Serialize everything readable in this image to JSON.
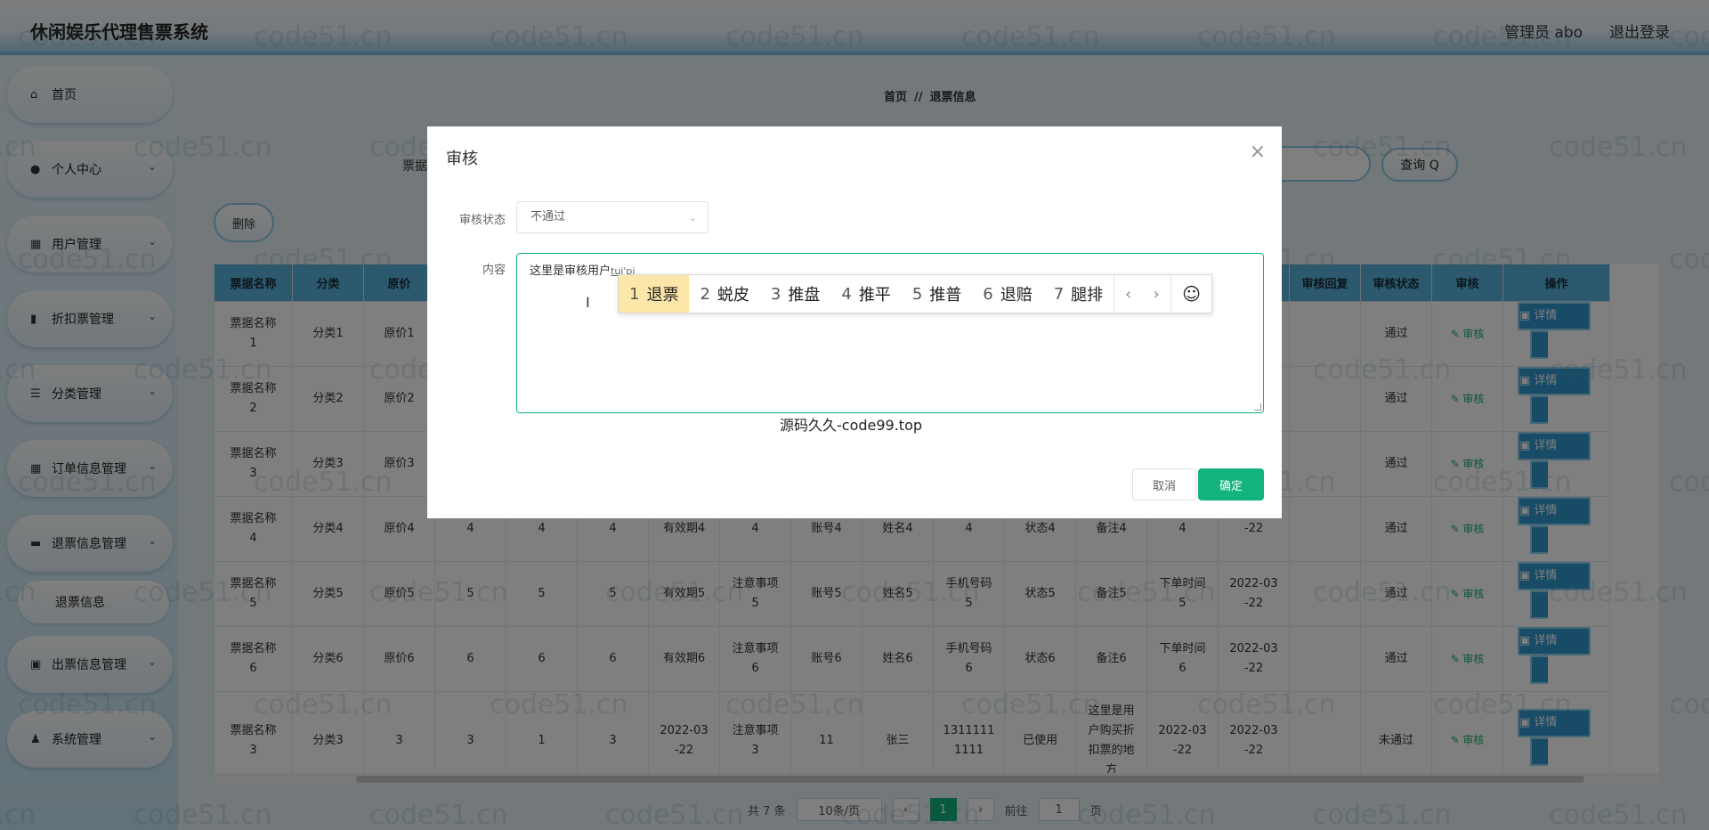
{
  "app": {
    "title": "休闲娱乐代理售票系统",
    "admin_label": "管理员 abo",
    "logout_label": "退出登录"
  },
  "sidebar": {
    "items": [
      {
        "label": "首页",
        "icon": "home-icon"
      },
      {
        "label": "个人中心",
        "icon": "user-icon"
      },
      {
        "label": "用户管理",
        "icon": "grid-icon"
      },
      {
        "label": "折扣票管理",
        "icon": "chart-icon"
      },
      {
        "label": "分类管理",
        "icon": "list-icon"
      },
      {
        "label": "订单信息管理",
        "icon": "grid-icon"
      },
      {
        "label": "退票信息管理",
        "icon": "monitor-icon"
      },
      {
        "label": "出票信息管理",
        "icon": "printer-icon"
      },
      {
        "label": "系统管理",
        "icon": "person-icon"
      }
    ],
    "sub_item": "退票信息"
  },
  "breadcrumb": {
    "home": "首页",
    "sep": "//",
    "current": "退票信息"
  },
  "search": {
    "label": "票据",
    "button": "查询 Q"
  },
  "toolbar": {
    "delete_label": "删除"
  },
  "table": {
    "headers": [
      "票据名称",
      "分类",
      "原价"
    ],
    "right_headers": [
      "审核回复",
      "审核状态",
      "审核",
      "操作"
    ],
    "rows": [
      {
        "c": [
          "票据名称\n1",
          "分类1",
          "原价1"
        ],
        "status": "通过"
      },
      {
        "c": [
          "票据名称\n2",
          "分类2",
          "原价2"
        ],
        "status": "通过"
      },
      {
        "c": [
          "票据名称\n3",
          "分类3",
          "原价3"
        ],
        "status": "通过"
      },
      {
        "c": [
          "票据名称\n4",
          "分类4",
          "原价4",
          "4",
          "4",
          "4",
          "有效期4",
          "4",
          "账号4",
          "姓名4",
          "4",
          "状态4",
          "备注4",
          "4",
          "-22"
        ],
        "status": "通过"
      },
      {
        "c": [
          "票据名称\n5",
          "分类5",
          "原价5",
          "5",
          "5",
          "5",
          "有效期5",
          "注意事项\n5",
          "账号5",
          "姓名5",
          "手机号码\n5",
          "状态5",
          "备注5",
          "下单时间\n5",
          "2022-03\n-22"
        ],
        "status": "通过"
      },
      {
        "c": [
          "票据名称\n6",
          "分类6",
          "原价6",
          "6",
          "6",
          "6",
          "有效期6",
          "注意事项\n6",
          "账号6",
          "姓名6",
          "手机号码\n6",
          "状态6",
          "备注6",
          "下单时间\n6",
          "2022-03\n-22"
        ],
        "status": "通过"
      },
      {
        "c": [
          "票据名称\n3",
          "分类3",
          "3",
          "3",
          "1",
          "3",
          "2022-03\n-22",
          "注意事项\n3",
          "11",
          "张三",
          "1311111\n1111",
          "已使用",
          "这里是用\n户购买折\n扣票的地\n方",
          "2022-03\n-22",
          "2022-03\n-22"
        ],
        "status": "未通过"
      }
    ],
    "audit_label": "✎ 审核",
    "detail_label": "详情"
  },
  "pagination": {
    "total": "共 7 条",
    "page_size": "10条/页",
    "current": "1",
    "goto_label": "前往",
    "goto_value": "1",
    "page_unit": "页"
  },
  "dialog": {
    "title": "审核",
    "status_label": "审核状态",
    "status_value": "不通过",
    "content_label": "内容",
    "content_text": "这里是审核用户",
    "content_pinyin": "tui'pi",
    "ime_candidates": [
      "退票",
      "蜕皮",
      "推盘",
      "推平",
      "推普",
      "退赔",
      "腿排"
    ],
    "ime_numbers": [
      "1",
      "2",
      "3",
      "4",
      "5",
      "6",
      "7"
    ],
    "source_note": "源码久久-code99.top",
    "cancel_label": "取消",
    "ok_label": "确定"
  },
  "watermark": "code51.cn"
}
